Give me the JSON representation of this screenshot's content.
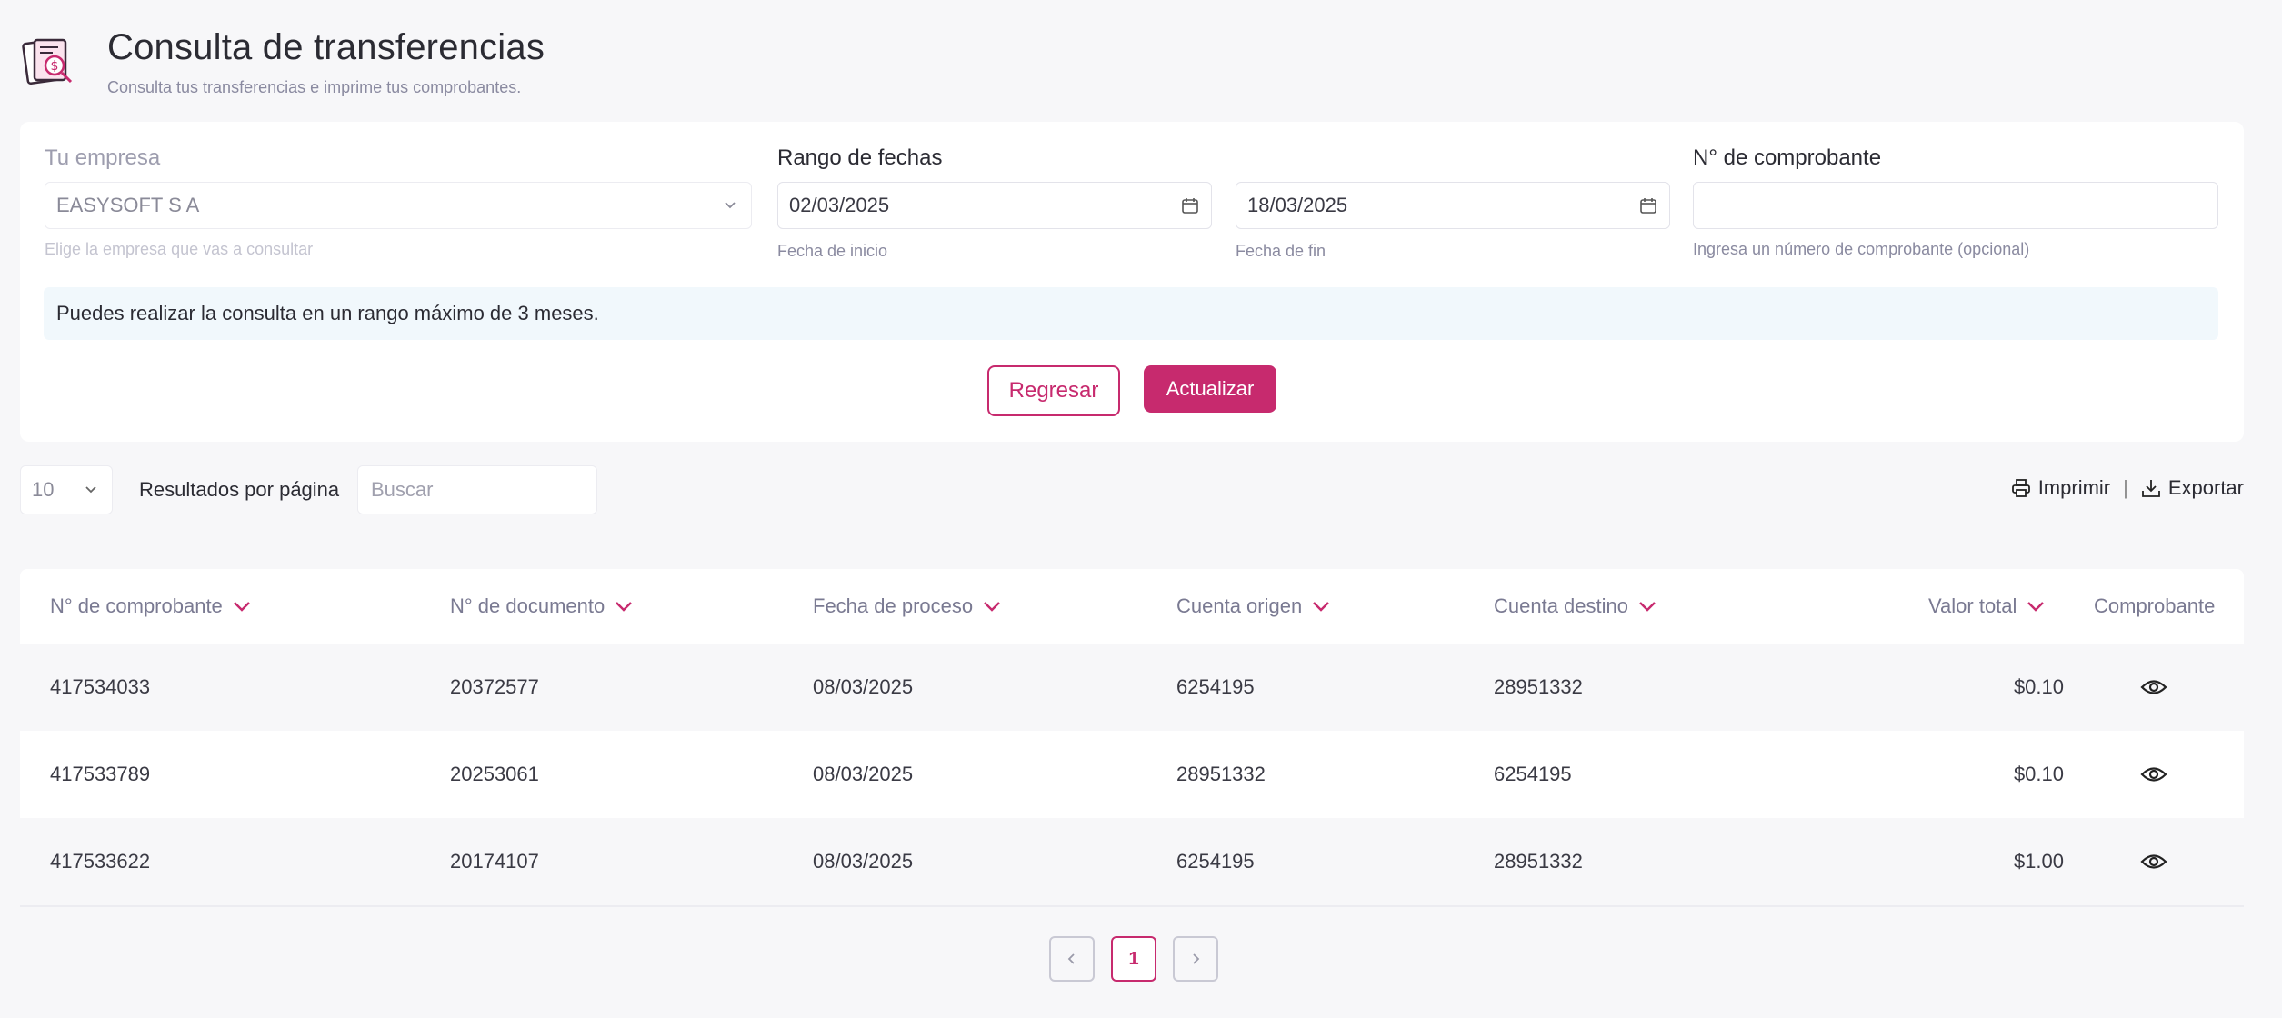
{
  "header": {
    "title": "Consulta de transferencias",
    "subtitle": "Consulta tus transferencias e imprime tus comprobantes."
  },
  "filters": {
    "company": {
      "label": "Tu empresa",
      "value": "EASYSOFT S A",
      "hint": "Elige la empresa que vas a consultar"
    },
    "date_range": {
      "label": "Rango de fechas",
      "start": {
        "value": "02/03/2025",
        "hint": "Fecha de inicio"
      },
      "end": {
        "value": "18/03/2025",
        "hint": "Fecha de fin"
      }
    },
    "voucher": {
      "label": "N° de comprobante",
      "value": "",
      "hint": "Ingresa un número de comprobante (opcional)"
    },
    "info": "Puedes realizar la consulta en un rango máximo de 3 meses.",
    "back_label": "Regresar",
    "update_label": "Actualizar"
  },
  "toolbar": {
    "page_size": "10",
    "results_label": "Resultados por página",
    "search_placeholder": "Buscar",
    "print_label": "Imprimir",
    "separator": "|",
    "export_label": "Exportar"
  },
  "table": {
    "columns": [
      "N° de comprobante",
      "N° de documento",
      "Fecha de proceso",
      "Cuenta origen",
      "Cuenta destino",
      "Valor total",
      "Comprobante"
    ],
    "rows": [
      [
        "417534033",
        "20372577",
        "08/03/2025",
        "6254195",
        "28951332",
        "$0.10"
      ],
      [
        "417533789",
        "20253061",
        "08/03/2025",
        "28951332",
        "6254195",
        "$0.10"
      ],
      [
        "417533622",
        "20174107",
        "08/03/2025",
        "6254195",
        "28951332",
        "$1.00"
      ]
    ]
  },
  "pagination": {
    "current": "1"
  },
  "colors": {
    "accent": "#c72a6e",
    "background": "#f7f7f9",
    "info_bg": "#f1f8fc"
  },
  "icons": [
    "document-money-icon",
    "chevron-down-icon",
    "calendar-icon",
    "printer-icon",
    "download-icon",
    "sort-chevron-icon",
    "eye-icon",
    "chevron-left-icon",
    "chevron-right-icon"
  ]
}
